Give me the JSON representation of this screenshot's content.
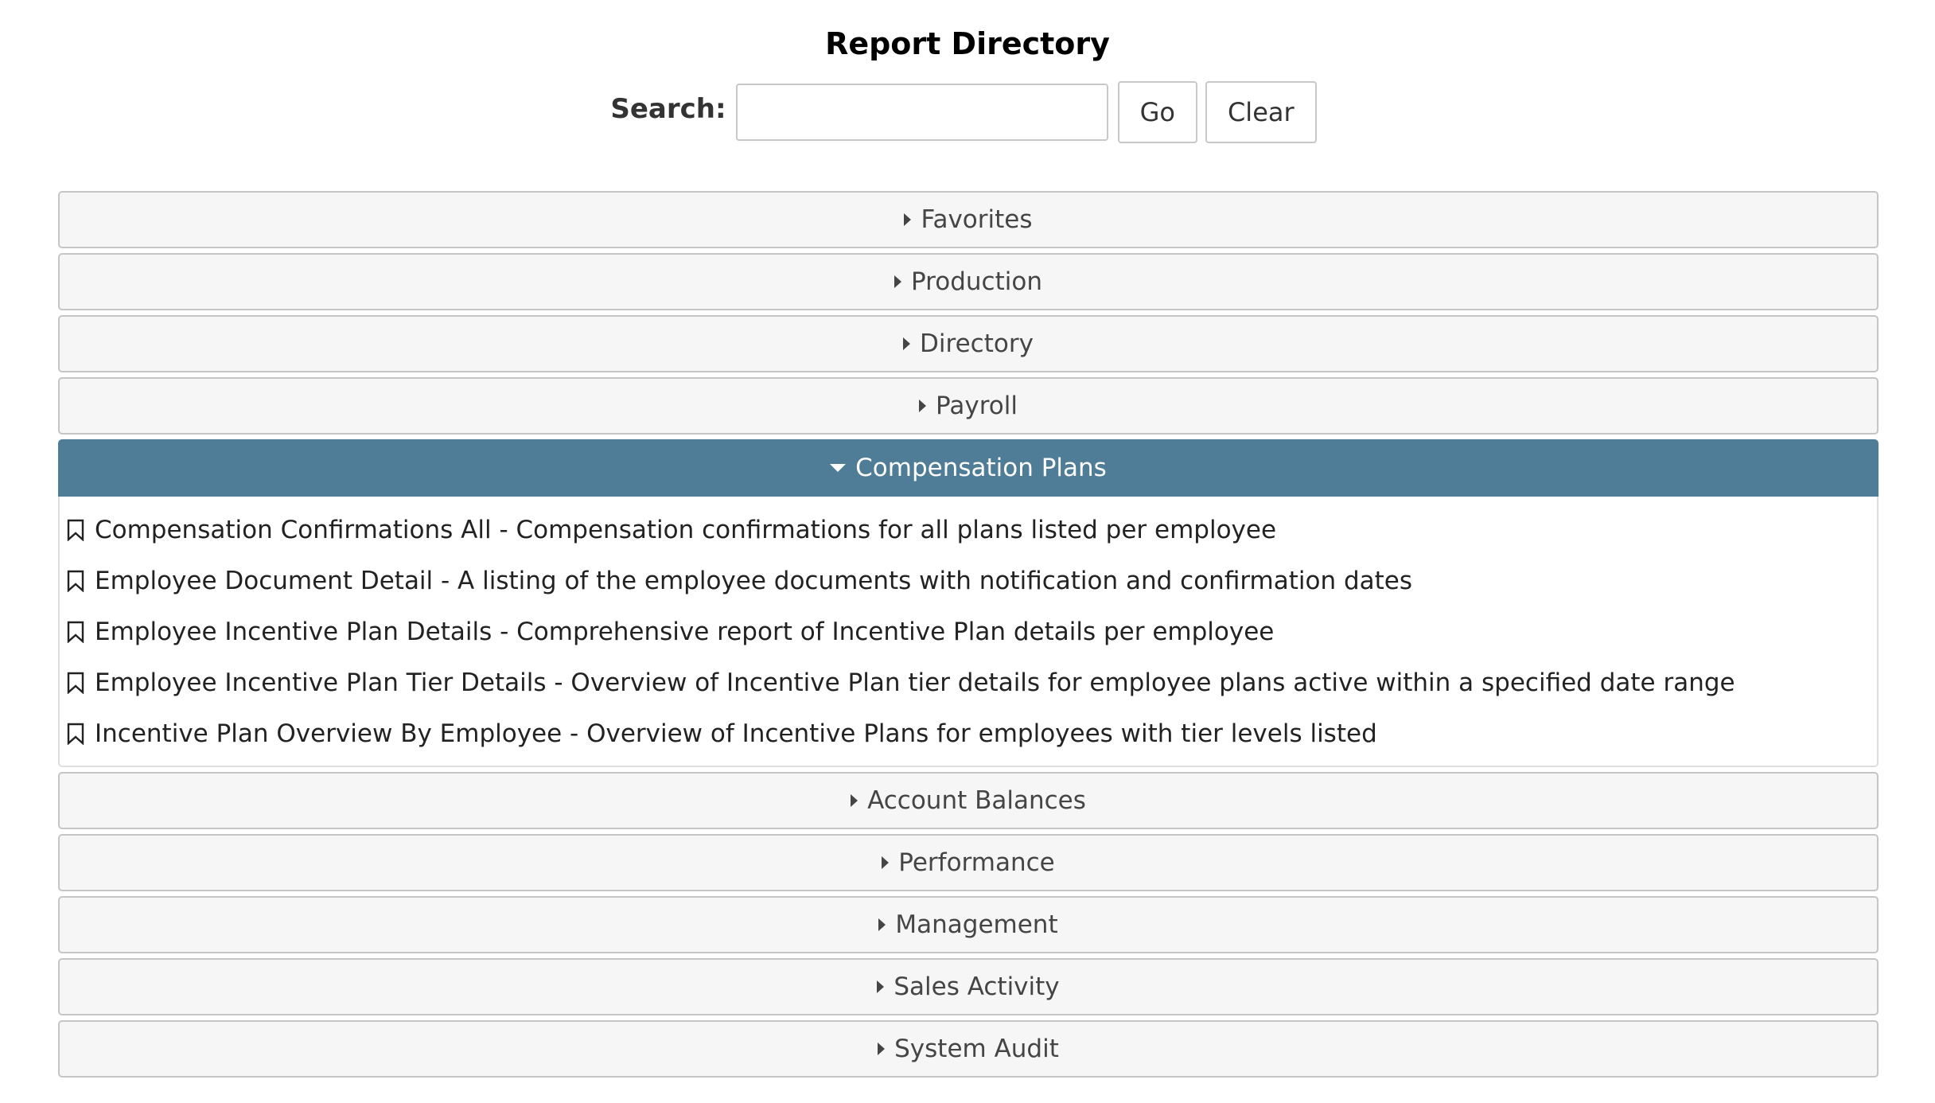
{
  "page": {
    "title": "Report Directory"
  },
  "search": {
    "label": "Search:",
    "value": "",
    "placeholder": "",
    "go_label": "Go",
    "clear_label": "Clear"
  },
  "sections": [
    {
      "label": "Favorites",
      "expanded": false
    },
    {
      "label": "Production",
      "expanded": false
    },
    {
      "label": "Directory",
      "expanded": false
    },
    {
      "label": "Payroll",
      "expanded": false
    },
    {
      "label": "Compensation Plans",
      "expanded": true
    },
    {
      "label": "Account Balances",
      "expanded": false
    },
    {
      "label": "Performance",
      "expanded": false
    },
    {
      "label": "Management",
      "expanded": false
    },
    {
      "label": "Sales Activity",
      "expanded": false
    },
    {
      "label": "System Audit",
      "expanded": false
    }
  ],
  "compensation_plans_reports": [
    "Compensation Confirmations All - Compensation confirmations for all plans listed per employee",
    "Employee Document Detail - A listing of the employee documents with notification and confirmation dates",
    "Employee Incentive Plan Details - Comprehensive report of Incentive Plan details per employee",
    "Employee Incentive Plan Tier Details - Overview of Incentive Plan tier details for employee plans active within a specified date range",
    "Incentive Plan Overview By Employee - Overview of Incentive Plans for employees with tier levels listed"
  ],
  "icons": {
    "bookmark": "bookmark-icon",
    "collapsed": "caret-right-icon",
    "expanded": "caret-down-icon"
  },
  "colors": {
    "active_header": "#4f7c96",
    "header_bg": "#f6f6f6",
    "border": "#c5c5c5"
  }
}
